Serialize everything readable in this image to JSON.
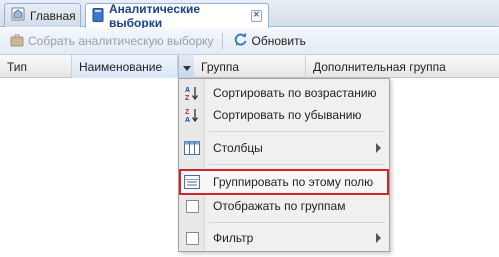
{
  "tabs": [
    {
      "label": "Главная",
      "icon": "home-doc-icon"
    },
    {
      "label": "Аналитические выборки",
      "icon": "book-icon",
      "active": true
    }
  ],
  "toolbar": {
    "collect_label": "Собрать аналитическую выборку",
    "refresh_label": "Обновить"
  },
  "grid": {
    "columns": [
      "Тип",
      "Наименование",
      "Группа",
      "Дополнительная группа"
    ]
  },
  "menu": {
    "sort_asc": "Сортировать по возрастанию",
    "sort_desc": "Сортировать по убыванию",
    "columns": "Столбцы",
    "group_by": "Группировать по этому полю",
    "show_groups": "Отображать по группам",
    "filter": "Фильтр"
  },
  "colors": {
    "highlight_border": "#d2232a",
    "tab_text": "#15428b"
  }
}
